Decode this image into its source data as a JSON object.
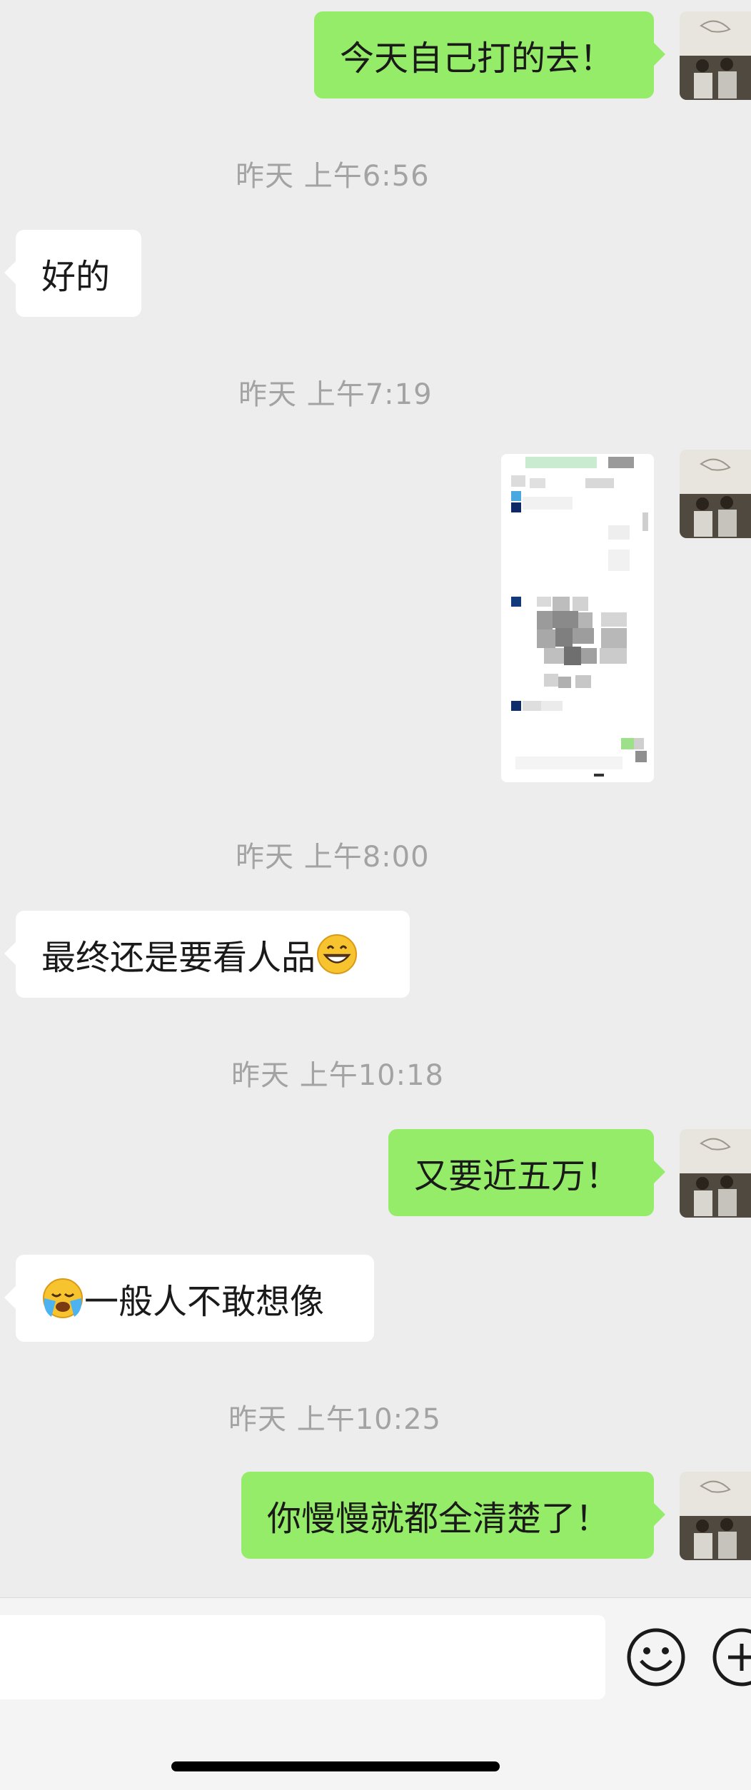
{
  "messages": {
    "m1": {
      "text": "今天自己打的去！"
    },
    "t1": "昨天 上午6:56",
    "m2": {
      "text": "好的"
    },
    "t2": "昨天 上午7:19",
    "t3": "昨天 上午8:00",
    "m4": {
      "text": "最终还是要看人品"
    },
    "t4": "昨天 上午10:18",
    "m5": {
      "text": "又要近五万！"
    },
    "m6": {
      "text": "一般人不敢想像"
    },
    "t5": "昨天 上午10:25",
    "m7": {
      "text": "你慢慢就都全清楚了！"
    }
  },
  "emojis": {
    "grin": "grinning-face",
    "cry": "loudly-crying-face"
  },
  "colors": {
    "sent_bubble": "#95ec69",
    "received_bubble": "#ffffff",
    "background": "#ededed",
    "timestamp": "#a3a3a3"
  },
  "input": {
    "value": ""
  }
}
